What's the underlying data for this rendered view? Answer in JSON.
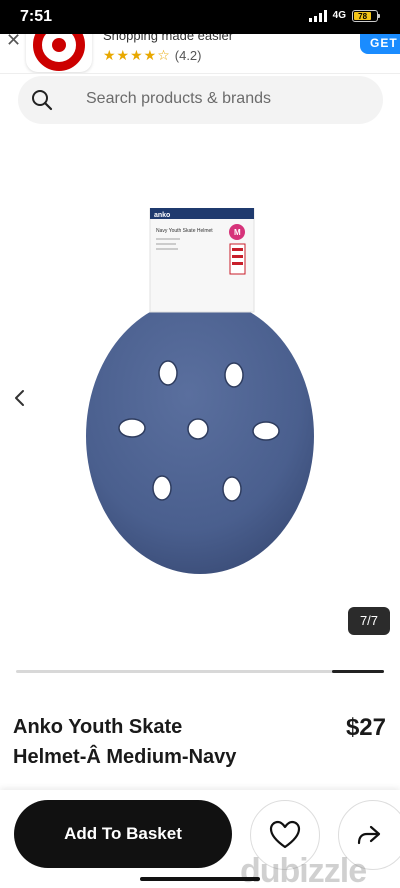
{
  "status": {
    "time": "7:51",
    "network": "4G",
    "battery": "78"
  },
  "banner": {
    "tagline": "Shopping made easier",
    "stars": "★★★★☆",
    "rating": "(4.2)",
    "get_label": "GET"
  },
  "search": {
    "placeholder": "Search products & brands"
  },
  "gallery": {
    "counter": "7/7",
    "package_brand": "anko",
    "package_title": "Navy Youth Skate Helmet",
    "package_size": "M",
    "scroll_position": 1.0
  },
  "product": {
    "title": "Anko Youth Skate Helmet-Â Medium-Navy",
    "price": "$27"
  },
  "actions": {
    "add_to_basket": "Add To Basket",
    "wishlist_icon": "heart-icon",
    "share_icon": "share-icon"
  },
  "watermark": "dubizzle",
  "colors": {
    "helmet": "#4a5f8e",
    "accent_target": "#cc0000",
    "get_button": "#1a8cff",
    "primary_button": "#111111"
  }
}
